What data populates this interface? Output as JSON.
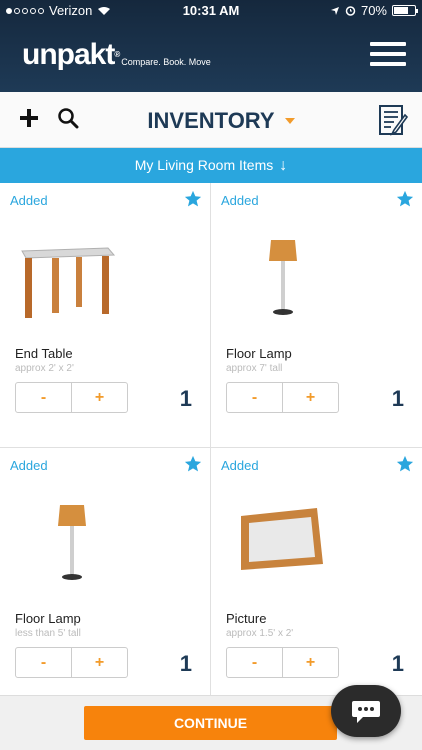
{
  "status_bar": {
    "carrier": "Verizon",
    "time": "10:31 AM",
    "battery": "70%",
    "battery_level": 0.7
  },
  "header": {
    "logo": "unpakt",
    "registered": "®",
    "tagline": "Compare. Book. Move",
    "menu_icon": "hamburger-icon"
  },
  "toolbar": {
    "title": "INVENTORY",
    "add_icon": "plus-icon",
    "search_icon": "search-icon",
    "notes_icon": "notepad-edit-icon",
    "dropdown_icon": "caret-down-icon"
  },
  "banner": {
    "label": "My Living Room Items",
    "arrow": "↓"
  },
  "items": [
    {
      "status": "Added",
      "name": "End Table",
      "size": "approx 2' x 2'",
      "minus": "-",
      "plus": "+",
      "qty": "1",
      "illustration": "end-table",
      "starred": true
    },
    {
      "status": "Added",
      "name": "Floor Lamp",
      "size": "approx 7' tall",
      "minus": "-",
      "plus": "+",
      "qty": "1",
      "illustration": "floor-lamp",
      "starred": true
    },
    {
      "status": "Added",
      "name": "Floor Lamp",
      "size": "less than 5' tall",
      "minus": "-",
      "plus": "+",
      "qty": "1",
      "illustration": "floor-lamp",
      "starred": true
    },
    {
      "status": "Added",
      "name": "Picture",
      "size": "approx 1.5' x 2'",
      "minus": "-",
      "plus": "+",
      "qty": "1",
      "illustration": "picture-frame",
      "starred": true
    }
  ],
  "footer": {
    "continue_label": "CONTINUE",
    "chat_icon": "chat-bubble-icon"
  },
  "colors": {
    "header_bg": "#1e3a56",
    "accent_blue": "#2aa6de",
    "accent_orange": "#f7830c",
    "stepper_orange": "#f29b2b"
  }
}
